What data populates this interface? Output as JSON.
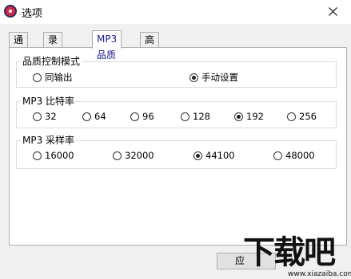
{
  "window": {
    "title": "选项",
    "close_icon": "close-icon"
  },
  "tabs": [
    {
      "label": "通用"
    },
    {
      "label": "录制设置"
    },
    {
      "label": "MP3品质",
      "active": true
    },
    {
      "label": "高级"
    }
  ],
  "quality_mode": {
    "label": "品质控制模式",
    "options": [
      {
        "label": "同输出",
        "checked": false
      },
      {
        "label": "手动设置",
        "checked": true
      }
    ]
  },
  "bitrate": {
    "label": "MP3 比特率",
    "options": [
      {
        "label": "32",
        "checked": false
      },
      {
        "label": "64",
        "checked": false
      },
      {
        "label": "96",
        "checked": false
      },
      {
        "label": "128",
        "checked": false
      },
      {
        "label": "192",
        "checked": true
      },
      {
        "label": "256",
        "checked": false
      }
    ]
  },
  "sample_rate": {
    "label": "MP3 采样率",
    "options": [
      {
        "label": "16000",
        "checked": false
      },
      {
        "label": "32000",
        "checked": false
      },
      {
        "label": "44100",
        "checked": true
      },
      {
        "label": "48000",
        "checked": false
      }
    ]
  },
  "footer": {
    "apply_label": "应"
  },
  "watermark": {
    "main": "下载吧",
    "sub": "www.xiazaiba.com"
  }
}
